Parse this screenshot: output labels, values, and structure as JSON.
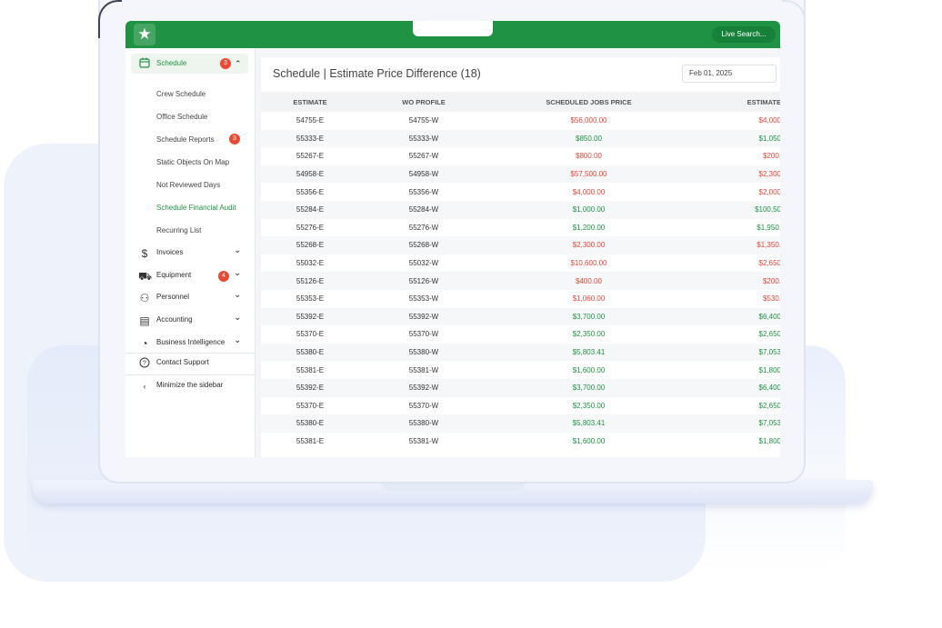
{
  "topbar": {
    "logo_glyph": "★",
    "search_label": "Live Search..."
  },
  "sidebar": {
    "schedule": {
      "label": "Schedule",
      "badge": "3",
      "chevron": "⌃",
      "icon": "calendar-icon"
    },
    "sub_items": [
      {
        "label": "Crew Schedule",
        "active": false,
        "badge": ""
      },
      {
        "label": "Office Schedule",
        "active": false,
        "badge": ""
      },
      {
        "label": "Schedule Reports",
        "active": false,
        "badge": "3"
      },
      {
        "label": "Static Objects On Map",
        "active": false,
        "badge": ""
      },
      {
        "label": "Not Reviewed Days",
        "active": false,
        "badge": ""
      },
      {
        "label": "Schedule Financial Audit",
        "active": true,
        "badge": ""
      },
      {
        "label": "Recurring List",
        "active": false,
        "badge": ""
      }
    ],
    "sections": [
      {
        "label": "Invoices",
        "glyph": "$",
        "icon": "dollar-icon",
        "badge": ""
      },
      {
        "label": "Equipment",
        "glyph": "⛟",
        "icon": "truck-icon",
        "badge": "4"
      },
      {
        "label": "Personnel",
        "glyph": "⚇",
        "icon": "person-icon",
        "badge": ""
      },
      {
        "label": "Accounting",
        "glyph": "▤",
        "icon": "ledger-icon",
        "badge": ""
      },
      {
        "label": "Business Intelligence",
        "glyph": "◔",
        "icon": "pie-chart-icon",
        "badge": ""
      }
    ],
    "contact_support": "Contact Support",
    "minimize": "Minimize the sidebar"
  },
  "main": {
    "title": "Schedule | Estimate Price Difference (18)",
    "date": "Feb 01, 2025",
    "columns": [
      "ESTIMATE",
      "WO PROFILE",
      "SCHEDULED JOBS PRICE",
      "ESTIMATE"
    ],
    "rows": [
      {
        "estimate": "54755-E",
        "wo": "54755-W",
        "price": "$56,000.00",
        "price_status": "neg",
        "est": "$4,000",
        "est_status": "neg"
      },
      {
        "estimate": "55333-E",
        "wo": "55333-W",
        "price": "$850.00",
        "price_status": "pos",
        "est": "$1,050",
        "est_status": "pos"
      },
      {
        "estimate": "55267-E",
        "wo": "55267-W",
        "price": "$800.00",
        "price_status": "neg",
        "est": "$200.",
        "est_status": "neg"
      },
      {
        "estimate": "54958-E",
        "wo": "54958-W",
        "price": "$57,500.00",
        "price_status": "neg",
        "est": "$2,300",
        "est_status": "neg"
      },
      {
        "estimate": "55356-E",
        "wo": "55356-W",
        "price": "$4,000.00",
        "price_status": "neg",
        "est": "$2,000",
        "est_status": "neg"
      },
      {
        "estimate": "55284-E",
        "wo": "55284-W",
        "price": "$1,000.00",
        "price_status": "pos",
        "est": "$100,50",
        "est_status": "pos"
      },
      {
        "estimate": "55276-E",
        "wo": "55276-W",
        "price": "$1,200.00",
        "price_status": "pos",
        "est": "$1,950.",
        "est_status": "pos"
      },
      {
        "estimate": "55268-E",
        "wo": "55268-W",
        "price": "$2,300.00",
        "price_status": "neg",
        "est": "$1,350.",
        "est_status": "neg"
      },
      {
        "estimate": "55032-E",
        "wo": "55032-W",
        "price": "$10,600.00",
        "price_status": "neg",
        "est": "$2,650",
        "est_status": "neg"
      },
      {
        "estimate": "55126-E",
        "wo": "55126-W",
        "price": "$400.00",
        "price_status": "neg",
        "est": "$200.",
        "est_status": "neg"
      },
      {
        "estimate": "55353-E",
        "wo": "55353-W",
        "price": "$1,060.00",
        "price_status": "neg",
        "est": "$530.",
        "est_status": "neg"
      },
      {
        "estimate": "55392-E",
        "wo": "55392-W",
        "price": "$3,700.00",
        "price_status": "pos",
        "est": "$6,400",
        "est_status": "pos"
      },
      {
        "estimate": "55370-E",
        "wo": "55370-W",
        "price": "$2,350.00",
        "price_status": "pos",
        "est": "$2,650",
        "est_status": "pos"
      },
      {
        "estimate": "55380-E",
        "wo": "55380-W",
        "price": "$5,803.41",
        "price_status": "pos",
        "est": "$7,053",
        "est_status": "pos"
      },
      {
        "estimate": "55381-E",
        "wo": "55381-W",
        "price": "$1,600.00",
        "price_status": "pos",
        "est": "$1,800",
        "est_status": "pos"
      },
      {
        "estimate": "55392-E",
        "wo": "55392-W",
        "price": "$3,700.00",
        "price_status": "pos",
        "est": "$6,400",
        "est_status": "pos"
      },
      {
        "estimate": "55370-E",
        "wo": "55370-W",
        "price": "$2,350.00",
        "price_status": "pos",
        "est": "$2,650",
        "est_status": "pos"
      },
      {
        "estimate": "55380-E",
        "wo": "55380-W",
        "price": "$5,803.41",
        "price_status": "pos",
        "est": "$7,053",
        "est_status": "pos"
      },
      {
        "estimate": "55381-E",
        "wo": "55381-W",
        "price": "$1,600.00",
        "price_status": "pos",
        "est": "$1,800",
        "est_status": "pos"
      }
    ]
  },
  "colors": {
    "brand_green": "#1f9243",
    "negative_red": "#e8463a",
    "badge_red": "#e84a35"
  }
}
